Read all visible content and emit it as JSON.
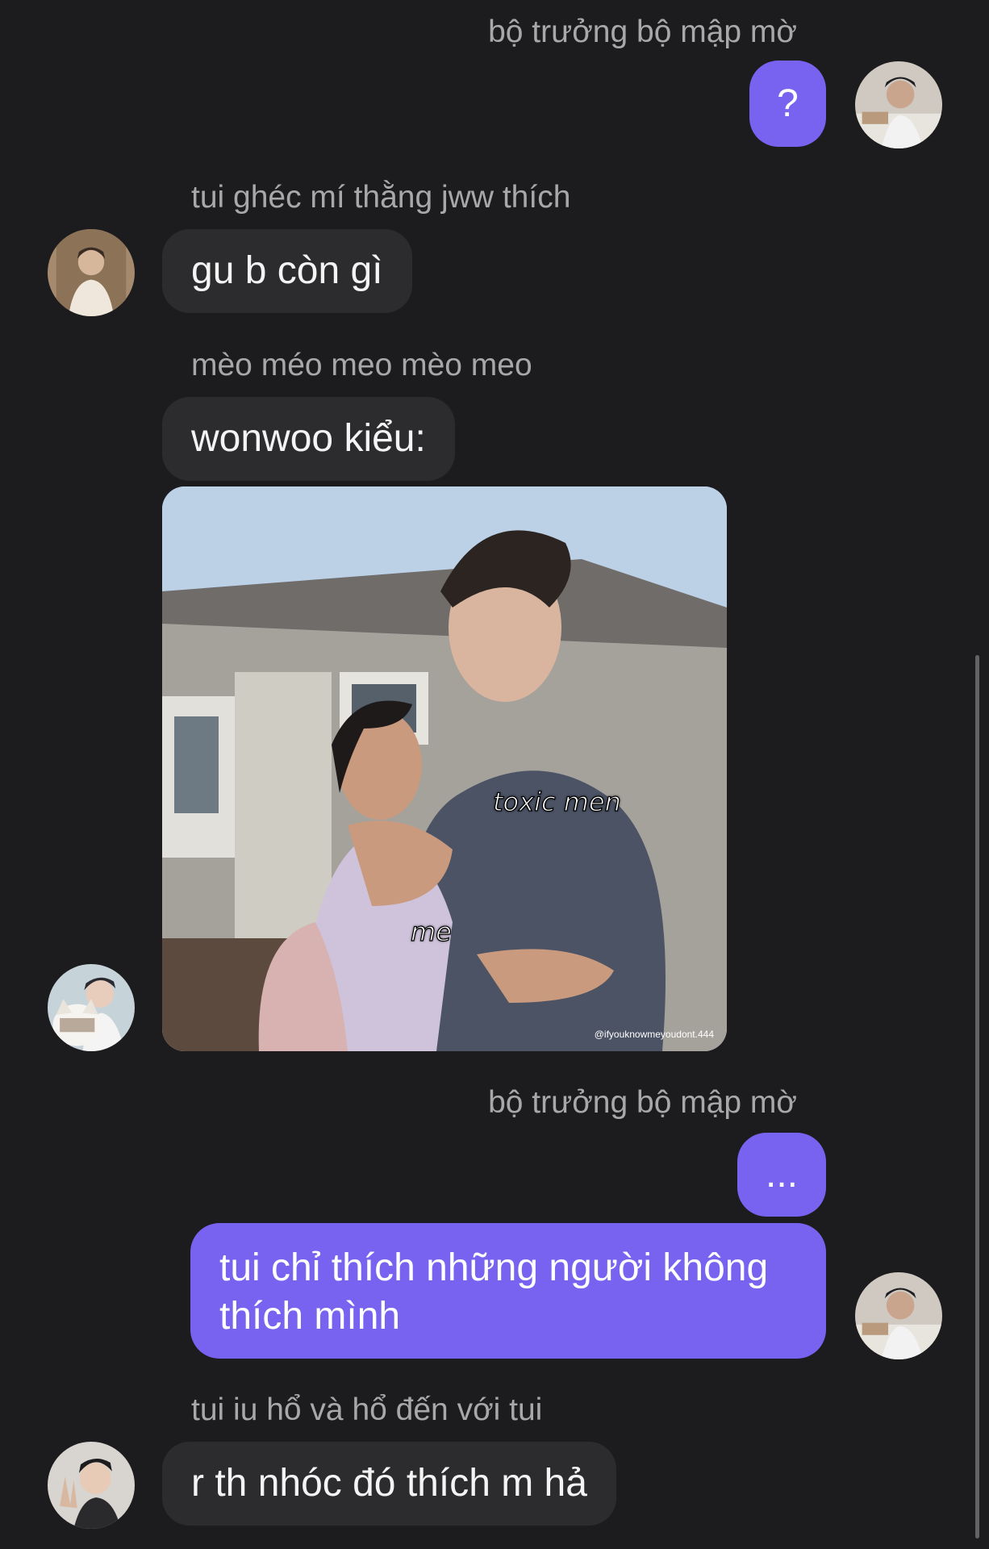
{
  "messages": [
    {
      "sender": "bộ trưởng bộ mập mờ",
      "text": "?"
    },
    {
      "sender": "tui ghéc mí thằng jww thích",
      "text": "gu b còn gì"
    },
    {
      "sender": "mèo méo meo mèo meo",
      "text": "wonwoo kiểu:"
    },
    {
      "sender": "bộ trưởng bộ mập mờ",
      "text": "...",
      "text2": "tui chỉ thích những người không thích mình"
    },
    {
      "sender": "tui iu hổ và hổ đến với tui",
      "text": "r th nhóc đó thích m hả"
    }
  ],
  "image_message": {
    "caption_toxic": "toxic men",
    "caption_me": "me",
    "watermark": "@ifyouknowmeyoudont.444"
  },
  "colors": {
    "background": "#1c1c1e",
    "incoming_bubble": "#2c2c2e",
    "outgoing_bubble": "#7863f0",
    "sender_name": "#a8a8ab"
  }
}
